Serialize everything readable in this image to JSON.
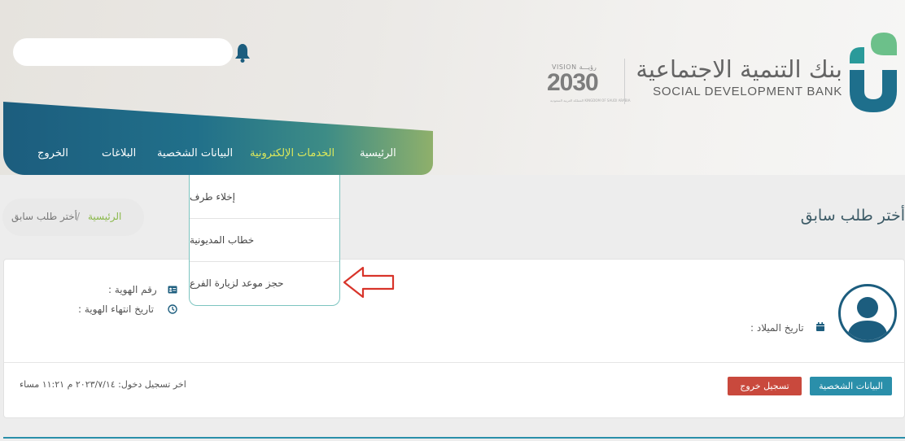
{
  "header": {
    "bank_name_ar": "بنك التنمية الاجتماعية",
    "bank_name_en": "SOCIAL DEVELOPMENT BANK",
    "vision": {
      "top": "VISION رؤيـــة",
      "year": "2030",
      "sub": "المملكة العربية السعودية KINGDOM OF SAUDI ARABIA"
    },
    "search_placeholder": ""
  },
  "nav": {
    "items": [
      "الرئيسية",
      "الخدمات الإلكترونية",
      "البيانات الشخصية",
      "البلاغات",
      "الخروج"
    ],
    "active_index": 1
  },
  "dropdown": {
    "items": [
      "إخلاء طرف",
      "خطاب المديونية",
      "حجز موعد لزيارة الفرع"
    ]
  },
  "breadcrumb": {
    "home": "الرئيسية",
    "separator": "/",
    "current": "أختر طلب سابق"
  },
  "page_title": "أختر طلب سابق",
  "profile": {
    "birth_date_label": "تاريخ الميلاد :",
    "id_number_label": "رقم الهوية :",
    "id_expiry_label": "تاريخ انتهاء الهوية :"
  },
  "footer": {
    "last_login": "اخر تسجيل دخول: ٢٠٢٣/٧/١٤ م ١١:٢١ مساء",
    "personal_button": "البيانات الشخصية",
    "logout_button": "تسجيل خروج"
  },
  "colors": {
    "nav_start": "#1c5d7e",
    "nav_end": "#8fb06b",
    "nav_active": "#dce85a",
    "accent": "#2a8faa",
    "logout": "#c9493d",
    "breadcrumb_home": "#8ab84a",
    "arrow": "#d8342a"
  },
  "icons": [
    "bell-icon",
    "sdb-logo",
    "calendar-icon",
    "id-card-icon",
    "clock-icon",
    "user-avatar-icon",
    "red-arrow-icon"
  ]
}
